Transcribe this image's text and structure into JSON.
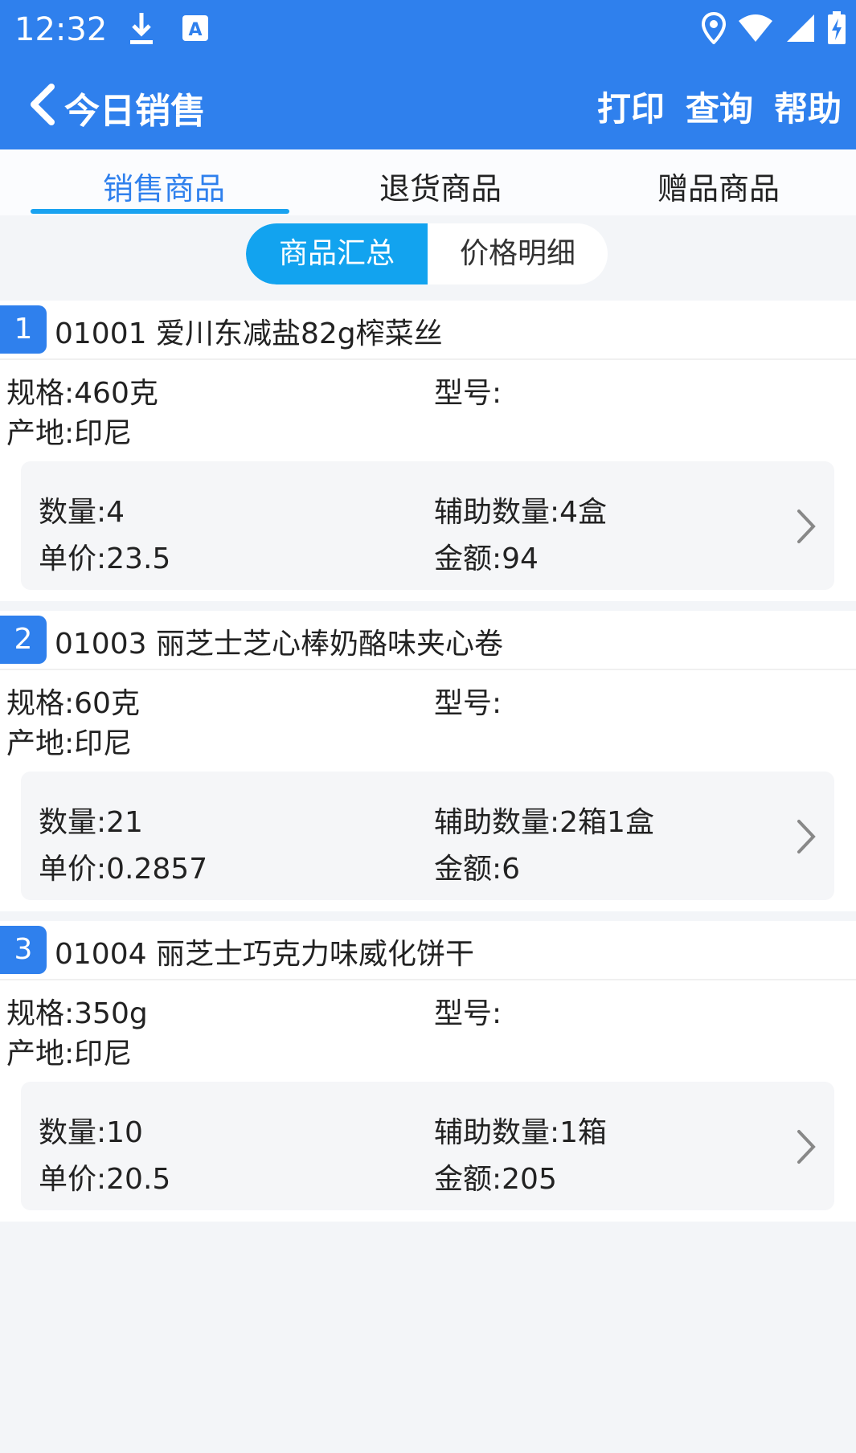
{
  "status_bar": {
    "time": "12:32",
    "icons": [
      "download-icon",
      "a-notification-icon",
      "location-icon",
      "wifi-icon",
      "signal-icon",
      "battery-charging-icon"
    ]
  },
  "header": {
    "title": "今日销售",
    "actions": {
      "print": "打印",
      "query": "查询",
      "help": "帮助"
    },
    "color": "#2f80ed"
  },
  "tabs": {
    "items": [
      "销售商品",
      "退货商品",
      "赠品商品"
    ],
    "active_index": 0,
    "accent": "#2f80ed"
  },
  "segment": {
    "options": [
      "商品汇总",
      "价格明细"
    ],
    "selected": "商品汇总",
    "accent": "#12a3ef"
  },
  "products": [
    {
      "index": "1",
      "name": "01001 爱川东减盐82g榨菜丝",
      "spec": "规格:460克",
      "model": "型号:",
      "origin": "产地:印尼",
      "quantity": "数量:4",
      "aux_quantity": "辅助数量:4盒",
      "unit_price": "单价:23.5",
      "amount": "金额:94"
    },
    {
      "index": "2",
      "name": "01003 丽芝士芝心棒奶酪味夹心卷",
      "spec": "规格:60克",
      "model": "型号:",
      "origin": "产地:印尼",
      "quantity": "数量:21",
      "aux_quantity": "辅助数量:2箱1盒",
      "unit_price": "单价:0.2857",
      "amount": "金额:6"
    },
    {
      "index": "3",
      "name": "01004 丽芝士巧克力味威化饼干",
      "spec": "规格:350g",
      "model": "型号:",
      "origin": "产地:印尼",
      "quantity": "数量:10",
      "aux_quantity": "辅助数量:1箱",
      "unit_price": "单价:20.5",
      "amount": "金额:205"
    }
  ]
}
